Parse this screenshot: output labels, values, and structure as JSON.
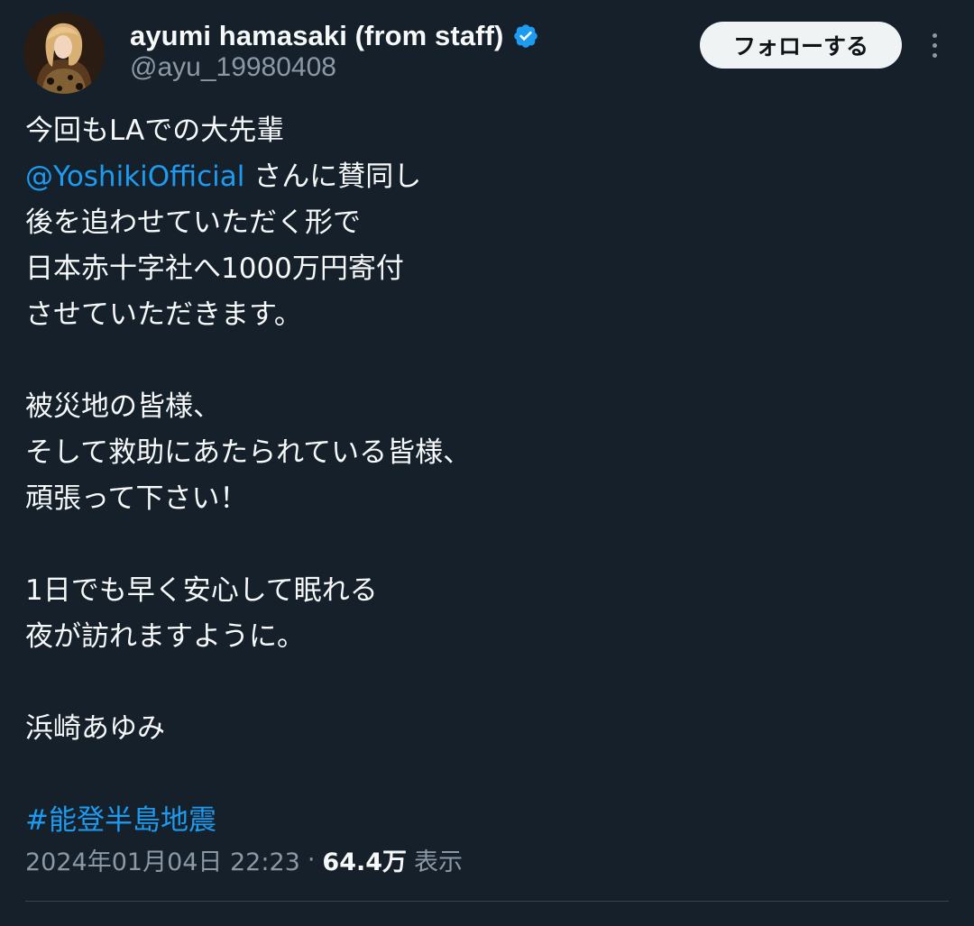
{
  "user": {
    "display_name": "ayumi hamasaki (from staff)",
    "handle": "@ayu_19980408",
    "verified": true
  },
  "follow_button_label": "フォローする",
  "more_icon": "more-vertical-icon",
  "tweet": {
    "line1": "今回もLAでの大先輩",
    "mention": "@YoshikiOfficial",
    "line2_rest": " さんに賛同し",
    "line3": "後を追わせていただく形で",
    "line4": "日本赤十字社へ1000万円寄付",
    "line5": "させていただきます。",
    "line6": "被災地の皆様、",
    "line7": "そして救助にあたられている皆様、",
    "line8": "頑張って下さい！",
    "line9": "1日でも早く安心して眠れる",
    "line10": "夜が訪れますように。",
    "signature": "浜崎あゆみ",
    "hashtag": "#能登半島地震"
  },
  "meta": {
    "timestamp": "2024年01月04日 22:23",
    "separator": "·",
    "views_count": "64.4万",
    "views_label": "表示"
  },
  "colors": {
    "background": "#15202b",
    "text": "#f7f9f9",
    "secondary": "#8b98a5",
    "link": "#1d9bf0",
    "verified": "#1d9bf0",
    "follow_bg": "#eff3f4"
  }
}
